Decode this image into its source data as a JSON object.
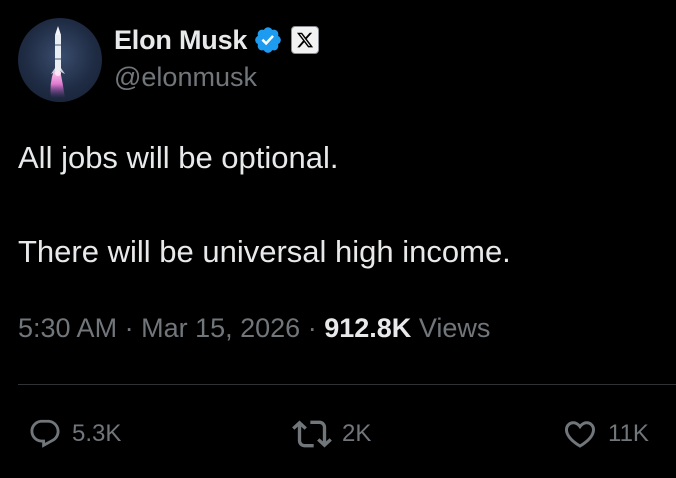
{
  "author": {
    "display_name": "Elon Musk",
    "handle": "@elonmusk",
    "verified": true,
    "verified_color": "#1d9bf0",
    "affiliation_icon": "x-logo-icon",
    "avatar_icon": "rocket-avatar"
  },
  "tweet": {
    "lines": [
      "All jobs will be optional.",
      "There will be universal high income."
    ]
  },
  "meta": {
    "time": "5:30 AM",
    "separator": "·",
    "date": "Mar 15, 2026",
    "views_count": "912.8K",
    "views_label": "Views"
  },
  "actions": {
    "reply_count": "5.3K",
    "repost_count": "2K",
    "like_count": "11K"
  },
  "colors": {
    "background": "#000000",
    "text_primary": "#e7e9ea",
    "text_secondary": "#71767b",
    "divider": "#2f3336"
  }
}
